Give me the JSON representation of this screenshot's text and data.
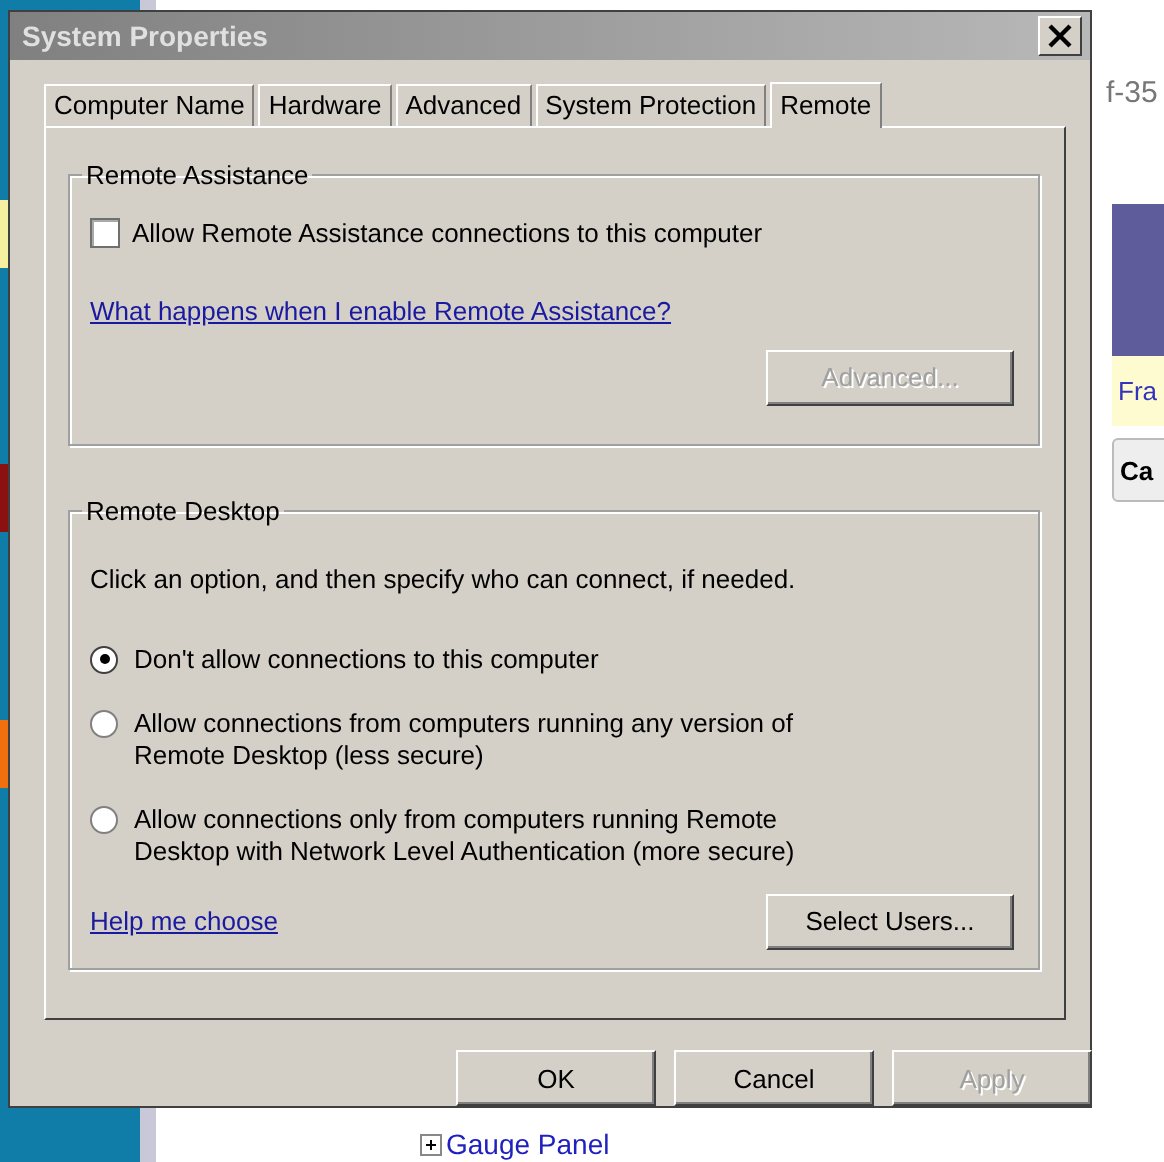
{
  "background": {
    "url_fragment": "f-35",
    "link": "Fra",
    "button": "Ca",
    "tree_item": "Gauge Panel"
  },
  "window": {
    "title": "System Properties"
  },
  "tabs": [
    {
      "label": "Computer Name",
      "selected": false
    },
    {
      "label": "Hardware",
      "selected": false
    },
    {
      "label": "Advanced",
      "selected": false
    },
    {
      "label": "System Protection",
      "selected": false
    },
    {
      "label": "Remote",
      "selected": true
    }
  ],
  "remote_assistance": {
    "legend": "Remote Assistance",
    "allow": {
      "label": "Allow Remote Assistance connections to this computer",
      "checked": false
    },
    "help_link": "What happens when I enable Remote Assistance?",
    "advanced_button": {
      "label": "Advanced...",
      "disabled": true
    }
  },
  "remote_desktop": {
    "legend": "Remote Desktop",
    "instruction": "Click an option, and then specify who can connect, if needed.",
    "options": [
      {
        "label": "Don't allow connections to this computer",
        "selected": true
      },
      {
        "label": "Allow connections from computers running any version of Remote Desktop (less secure)",
        "selected": false
      },
      {
        "label": "Allow connections only from computers running Remote Desktop with Network Level Authentication (more secure)",
        "selected": false
      }
    ],
    "help_link": "Help me choose",
    "select_users_button": {
      "label": "Select Users...",
      "disabled": false
    }
  },
  "buttons": [
    {
      "label": "OK",
      "disabled": false
    },
    {
      "label": "Cancel",
      "disabled": false
    },
    {
      "label": "Apply",
      "disabled": true
    }
  ]
}
